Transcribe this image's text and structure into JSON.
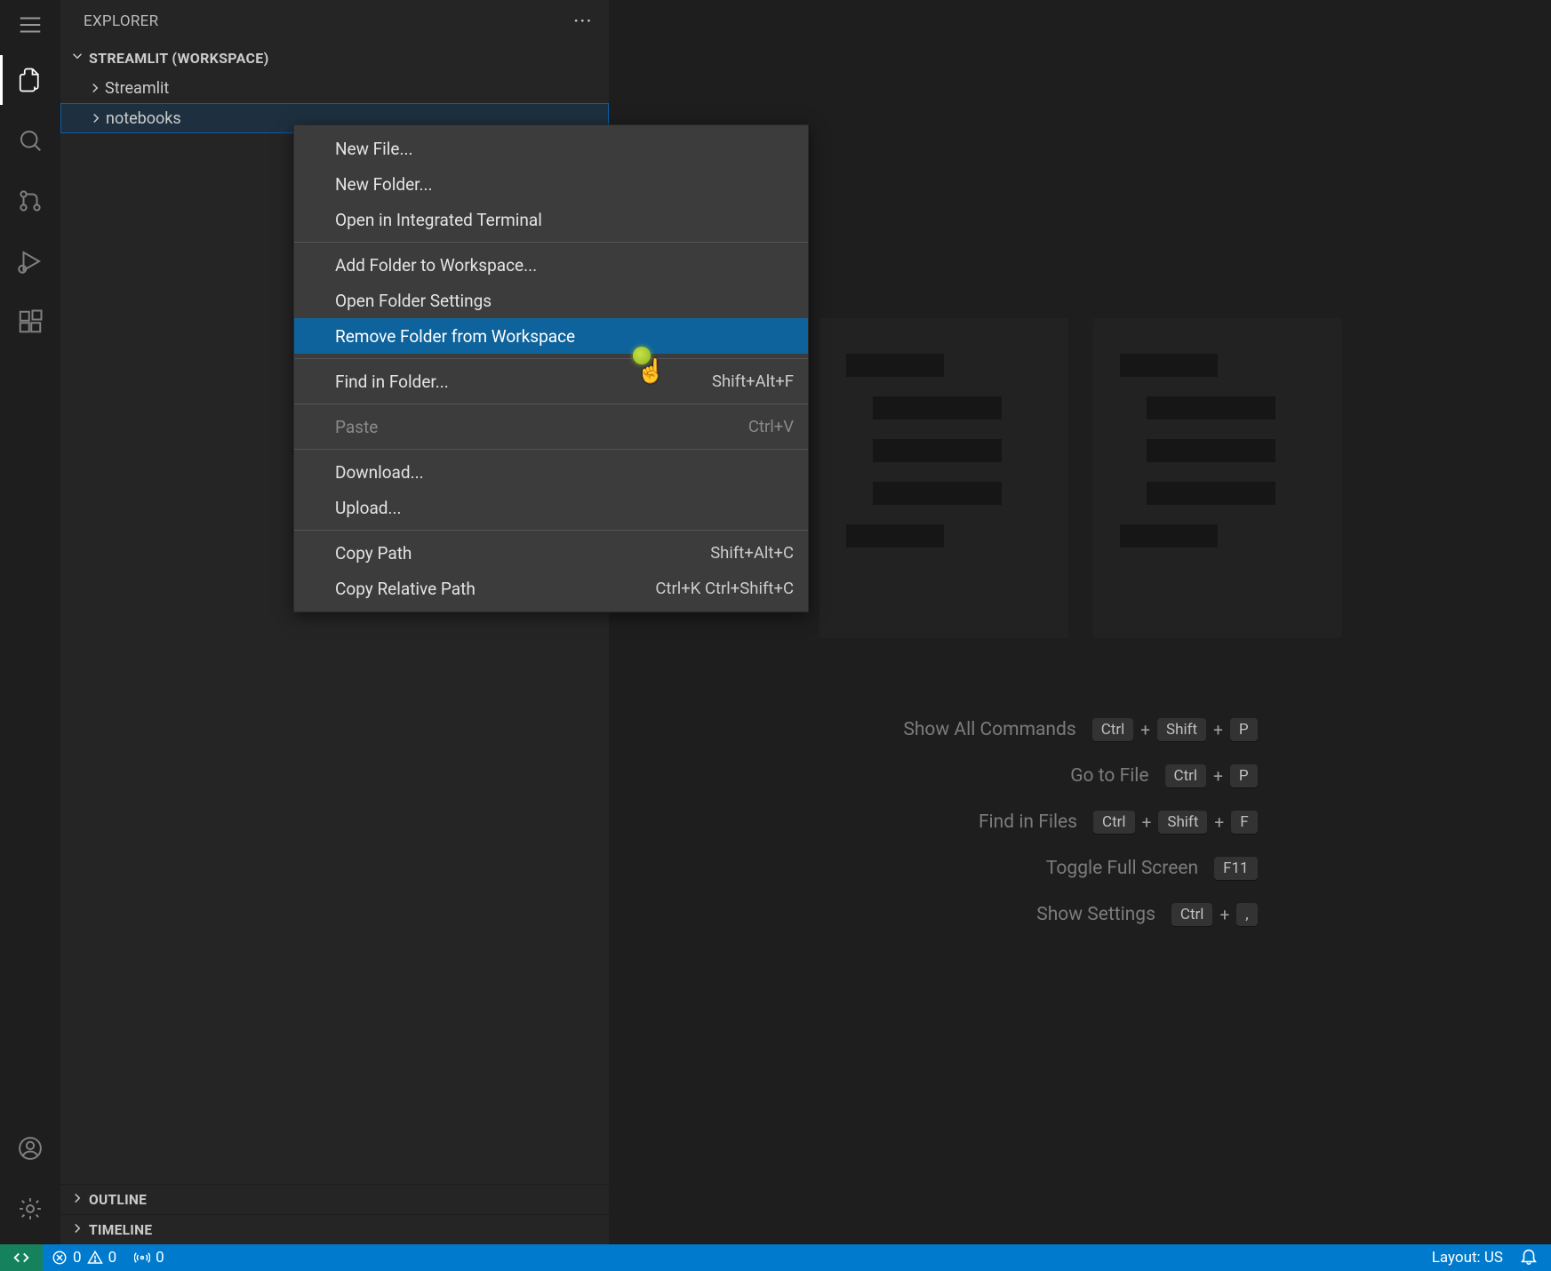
{
  "sidebar": {
    "title": "EXPLORER",
    "workspace_label": "STREAMLIT (WORKSPACE)",
    "tree": [
      {
        "label": "Streamlit"
      },
      {
        "label": "notebooks"
      }
    ],
    "sections": {
      "outline": "OUTLINE",
      "timeline": "TIMELINE"
    }
  },
  "context_menu": {
    "groups": [
      [
        {
          "label": "New File..."
        },
        {
          "label": "New Folder..."
        },
        {
          "label": "Open in Integrated Terminal"
        }
      ],
      [
        {
          "label": "Add Folder to Workspace..."
        },
        {
          "label": "Open Folder Settings"
        },
        {
          "label": "Remove Folder from Workspace",
          "highlight": true
        }
      ],
      [
        {
          "label": "Find in Folder...",
          "shortcut": "Shift+Alt+F"
        }
      ],
      [
        {
          "label": "Paste",
          "shortcut": "Ctrl+V",
          "disabled": true
        }
      ],
      [
        {
          "label": "Download..."
        },
        {
          "label": "Upload..."
        }
      ],
      [
        {
          "label": "Copy Path",
          "shortcut": "Shift+Alt+C"
        },
        {
          "label": "Copy Relative Path",
          "shortcut": "Ctrl+K Ctrl+Shift+C"
        }
      ]
    ]
  },
  "welcome": {
    "shortcuts": [
      {
        "label": "Show All Commands",
        "keys": [
          "Ctrl",
          "Shift",
          "P"
        ]
      },
      {
        "label": "Go to File",
        "keys": [
          "Ctrl",
          "P"
        ]
      },
      {
        "label": "Find in Files",
        "keys": [
          "Ctrl",
          "Shift",
          "F"
        ]
      },
      {
        "label": "Toggle Full Screen",
        "keys": [
          "F11"
        ]
      },
      {
        "label": "Show Settings",
        "keys": [
          "Ctrl",
          ","
        ]
      }
    ]
  },
  "statusbar": {
    "errors": "0",
    "warnings": "0",
    "ports": "0",
    "layout": "Layout: US"
  }
}
